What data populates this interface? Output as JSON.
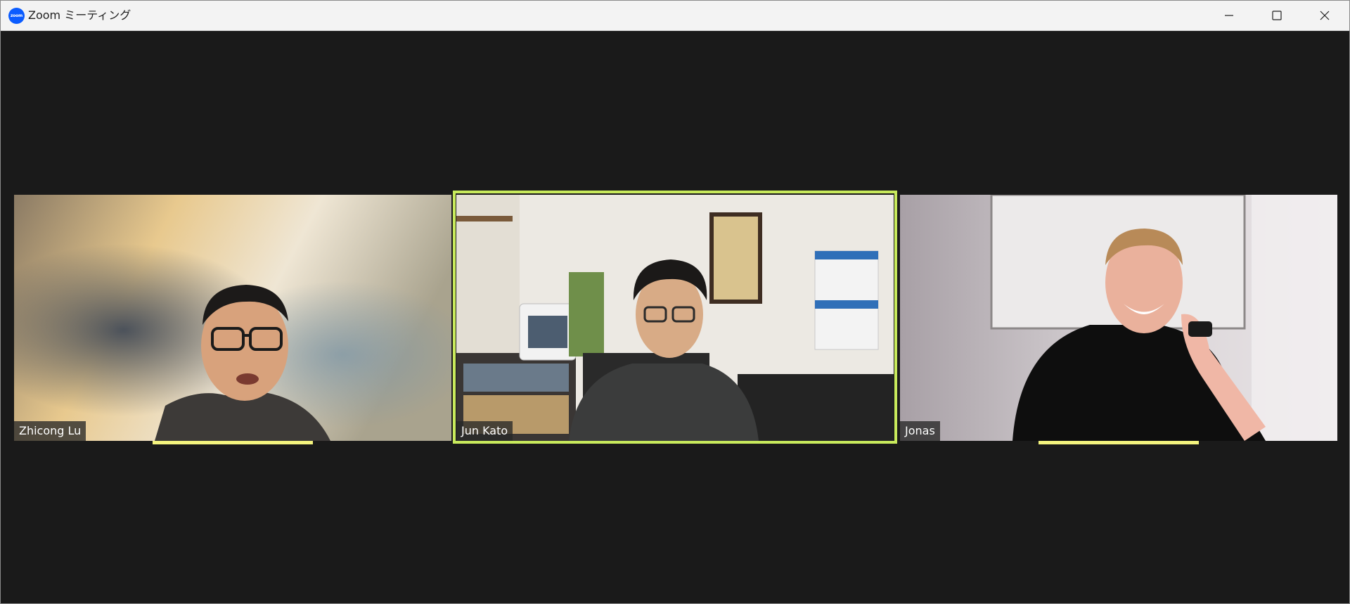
{
  "window": {
    "app_icon_text": "zoom",
    "title": "Zoom ミーティング",
    "controls": {
      "minimize_icon": "minimize-icon",
      "maximize_icon": "maximize-icon",
      "close_icon": "close-icon"
    }
  },
  "participants": [
    {
      "name": "Zhicong Lu",
      "speaking_indicator": true,
      "active_speaker": false
    },
    {
      "name": "Jun Kato",
      "speaking_indicator": false,
      "active_speaker": true
    },
    {
      "name": "Jonas",
      "speaking_indicator": true,
      "active_speaker": false
    }
  ],
  "colors": {
    "background": "#1a1a1a",
    "titlebar": "#f3f3f3",
    "zoom_blue": "#0b5cff",
    "active_speaker_border": "#c8ea5c",
    "speaking_bar": "#f4f47e"
  }
}
